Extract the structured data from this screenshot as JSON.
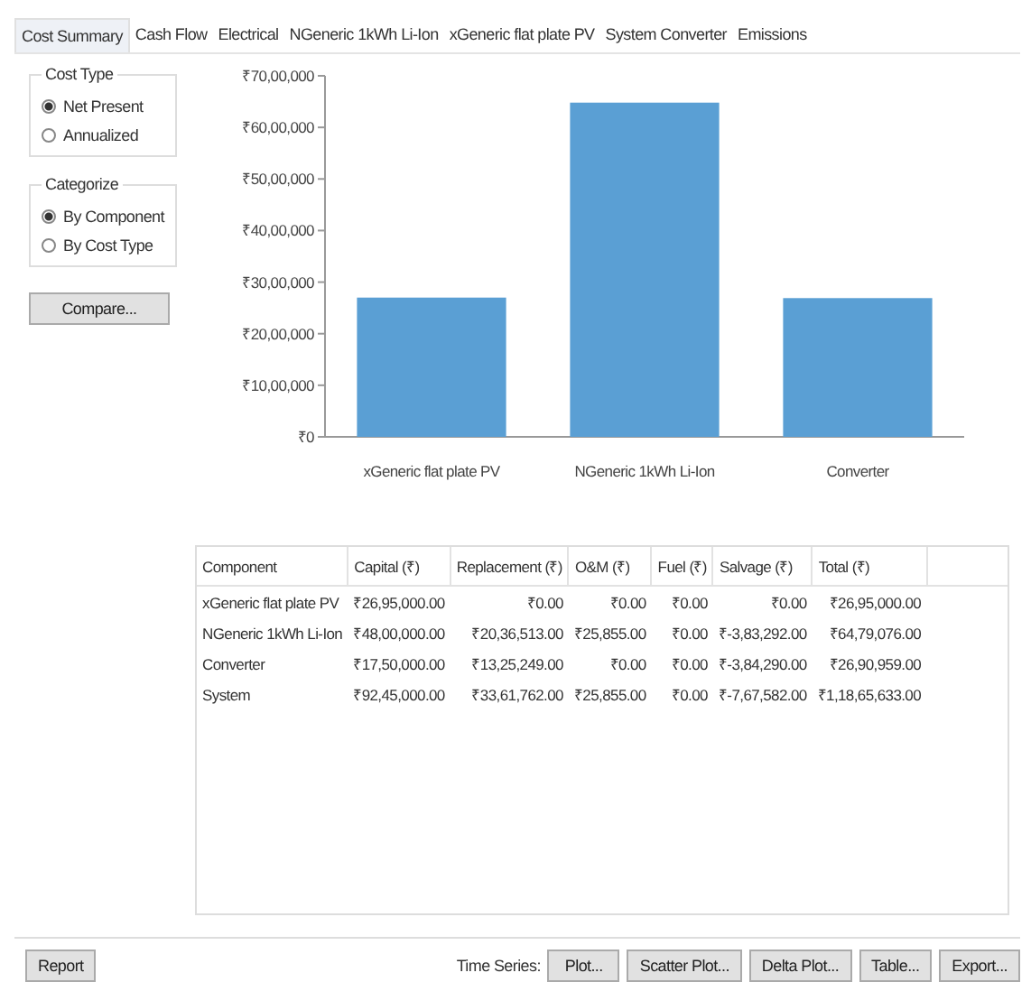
{
  "tabs": [
    {
      "label": "Cost Summary",
      "selected": true
    },
    {
      "label": "Cash Flow",
      "selected": false
    },
    {
      "label": "Electrical",
      "selected": false
    },
    {
      "label": "NGeneric 1kWh Li-Ion",
      "selected": false
    },
    {
      "label": "xGeneric flat plate PV",
      "selected": false
    },
    {
      "label": "System Converter",
      "selected": false
    },
    {
      "label": "Emissions",
      "selected": false
    }
  ],
  "option_groups": [
    {
      "title": "Cost Type",
      "options": [
        {
          "label": "Net Present",
          "selected": true
        },
        {
          "label": "Annualized",
          "selected": false
        }
      ]
    },
    {
      "title": "Categorize",
      "options": [
        {
          "label": "By Component",
          "selected": true
        },
        {
          "label": "By Cost Type",
          "selected": false
        }
      ]
    }
  ],
  "compare_button": "Compare...",
  "chart_data": {
    "type": "bar",
    "categories": [
      "xGeneric flat plate PV",
      "NGeneric 1kWh Li-Ion",
      "Converter"
    ],
    "values": [
      2700000,
      6480000,
      2690000
    ],
    "ylim": [
      0,
      7000000
    ],
    "yticks": [
      {
        "value": 0,
        "label": "₹0"
      },
      {
        "value": 1000000,
        "label": "₹10,00,000"
      },
      {
        "value": 2000000,
        "label": "₹20,00,000"
      },
      {
        "value": 3000000,
        "label": "₹30,00,000"
      },
      {
        "value": 4000000,
        "label": "₹40,00,000"
      },
      {
        "value": 5000000,
        "label": "₹50,00,000"
      },
      {
        "value": 6000000,
        "label": "₹60,00,000"
      },
      {
        "value": 7000000,
        "label": "₹70,00,000"
      }
    ]
  },
  "table": {
    "columns": [
      "Component",
      "Capital (₹)",
      "Replacement (₹)",
      "O&M (₹)",
      "Fuel (₹)",
      "Salvage (₹)",
      "Total (₹)"
    ],
    "rows": [
      [
        "xGeneric flat plate PV",
        "₹26,95,000.00",
        "₹0.00",
        "₹0.00",
        "₹0.00",
        "₹0.00",
        "₹26,95,000.00"
      ],
      [
        "NGeneric 1kWh Li-Ion",
        "₹48,00,000.00",
        "₹20,36,513.00",
        "₹25,855.00",
        "₹0.00",
        "₹-3,83,292.00",
        "₹64,79,076.00"
      ],
      [
        "Converter",
        "₹17,50,000.00",
        "₹13,25,249.00",
        "₹0.00",
        "₹0.00",
        "₹-3,84,290.00",
        "₹26,90,959.00"
      ],
      [
        "System",
        "₹92,45,000.00",
        "₹33,61,762.00",
        "₹25,855.00",
        "₹0.00",
        "₹-7,67,582.00",
        "₹1,18,65,633.00"
      ]
    ]
  },
  "report_button": "Report",
  "time_series_label": "Time Series:",
  "time_series_buttons": [
    "Plot...",
    "Scatter Plot...",
    "Delta Plot...",
    "Table...",
    "Export..."
  ]
}
